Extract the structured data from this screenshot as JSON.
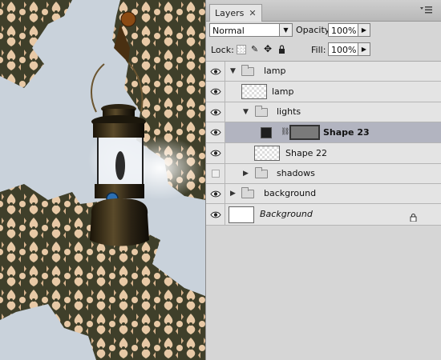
{
  "panel": {
    "tab_label": "Layers",
    "blend_mode": "Normal",
    "opacity_label": "Opacity:",
    "opacity_value": "100%",
    "lock_label": "Lock:",
    "fill_label": "Fill:",
    "fill_value": "100%"
  },
  "layers": [
    {
      "name": "lamp",
      "kind": "group",
      "expanded": true,
      "visible": true
    },
    {
      "name": "lamp",
      "kind": "layer",
      "visible": true
    },
    {
      "name": "lights",
      "kind": "group",
      "expanded": true,
      "visible": true
    },
    {
      "name": "Shape 23",
      "kind": "shape",
      "visible": true,
      "selected": true
    },
    {
      "name": "Shape 22",
      "kind": "layer",
      "visible": true
    },
    {
      "name": "shadows",
      "kind": "group",
      "expanded": false,
      "visible": false
    },
    {
      "name": "background",
      "kind": "group",
      "expanded": false,
      "visible": true
    },
    {
      "name": "Background",
      "kind": "background",
      "visible": true,
      "locked": true
    }
  ],
  "colors": {
    "panel_bg": "#d6d6d6",
    "selected_row": "#b2b4c0",
    "damask_dark": "#3f3f2a",
    "damask_light": "#e8c9a6",
    "wall": "#c9d2db"
  },
  "icons": [
    "eye-icon",
    "folder-icon",
    "chain-link-icon",
    "lock-icon",
    "panel-menu-icon",
    "close-icon",
    "chevron-down-icon",
    "chevron-right-icon",
    "move-icon",
    "brush-icon",
    "transparency-lock-icon"
  ]
}
